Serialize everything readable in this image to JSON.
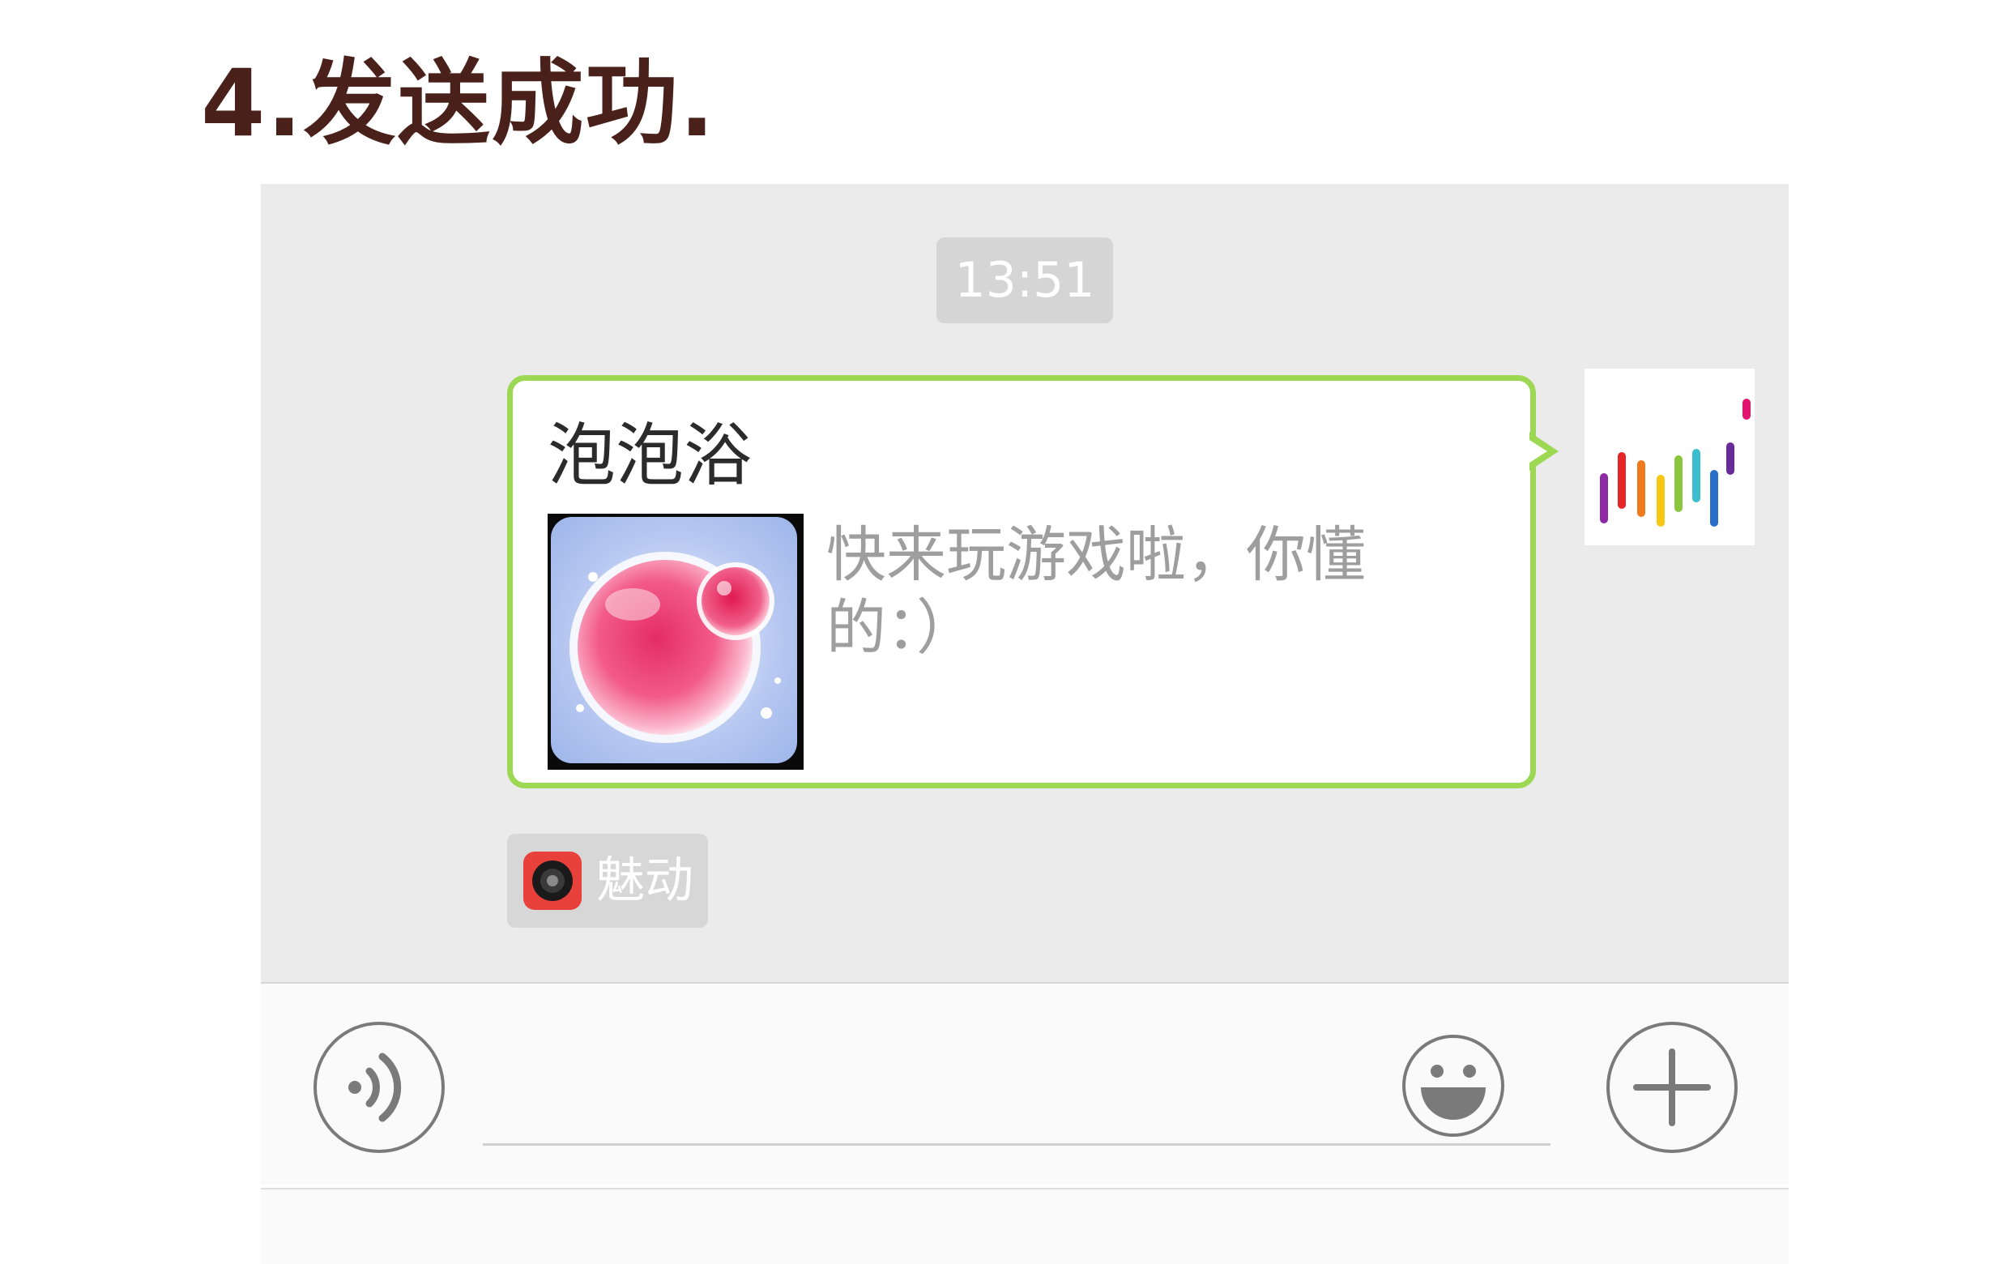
{
  "heading": "4.发送成功.",
  "chat": {
    "timestamp": "13:51",
    "message": {
      "title": "泡泡浴",
      "description": "快来玩游戏啦，你懂的：）",
      "thumbnail_icon": "pink-bubble-game-icon",
      "bubble_border_color": "#9dd854"
    },
    "avatar_icon": "colorful-bars-avatar",
    "source": {
      "name": "魅动",
      "icon": "meidong-app-icon"
    }
  },
  "input_bar": {
    "voice_icon": "voice-input-icon",
    "message_value": "",
    "emoji_icon": "emoji-icon",
    "add_icon": "add-icon"
  }
}
